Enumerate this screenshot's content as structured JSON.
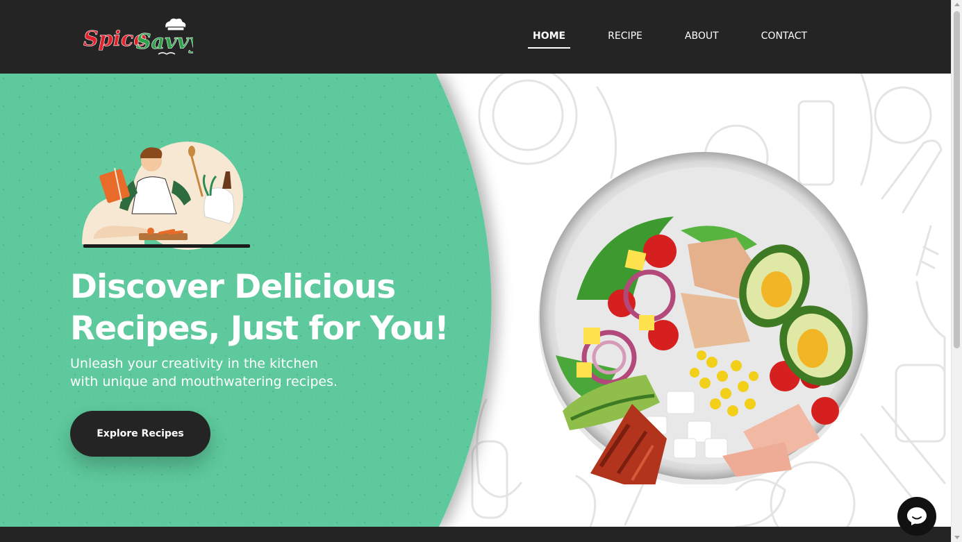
{
  "brand": {
    "name_part1": "Spice",
    "name_part2": "Savvy",
    "logo_icon": "chef-hat-icon"
  },
  "nav": {
    "items": [
      {
        "label": "HOME",
        "active": true
      },
      {
        "label": "RECIPE",
        "active": false
      },
      {
        "label": "ABOUT",
        "active": false
      },
      {
        "label": "CONTACT",
        "active": false
      }
    ]
  },
  "hero": {
    "headline_line1": "Discover Delicious",
    "headline_line2": "Recipes, Just for You!",
    "subtext_line1": "Unleash your creativity in the kitchen",
    "subtext_line2": "with unique and mouthwatering recipes.",
    "cta_label": "Explore Recipes"
  },
  "chat": {
    "icon": "chat-bubble-icon"
  },
  "colors": {
    "header_bg": "#242424",
    "hero_green": "#5dc99c",
    "brand_red": "#e0202a",
    "brand_green": "#2ca24a",
    "cta_bg": "#242424",
    "text_light": "#ffffff"
  }
}
